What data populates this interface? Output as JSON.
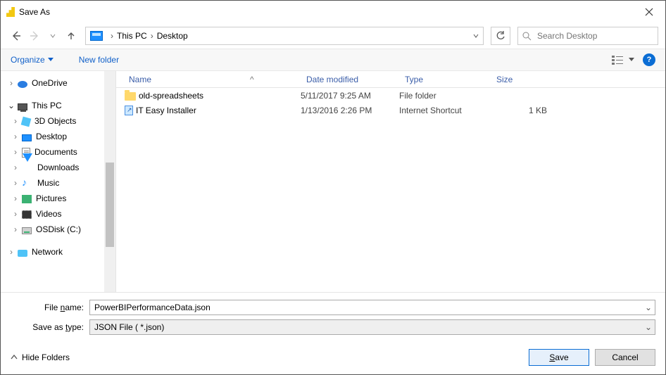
{
  "window": {
    "title": "Save As"
  },
  "breadcrumb": {
    "seg1": "This PC",
    "seg2": "Desktop"
  },
  "search": {
    "placeholder": "Search Desktop"
  },
  "toolbar": {
    "organize": "Organize",
    "newfolder": "New folder"
  },
  "tree": {
    "onedrive": "OneDrive",
    "thispc": "This PC",
    "objects3d": "3D Objects",
    "desktop": "Desktop",
    "documents": "Documents",
    "downloads": "Downloads",
    "music": "Music",
    "pictures": "Pictures",
    "videos": "Videos",
    "osdisk": "OSDisk (C:)",
    "network": "Network"
  },
  "columns": {
    "name": "Name",
    "date": "Date modified",
    "type": "Type",
    "size": "Size"
  },
  "rows": [
    {
      "name": "old-spreadsheets",
      "date": "5/11/2017 9:25 AM",
      "type": "File folder",
      "size": "",
      "kind": "folder"
    },
    {
      "name": "IT Easy Installer",
      "date": "1/13/2016 2:26 PM",
      "type": "Internet Shortcut",
      "size": "1 KB",
      "kind": "url"
    }
  ],
  "fields": {
    "filename_label_pre": "File ",
    "filename_label_u": "n",
    "filename_label_post": "ame:",
    "filename_value": "PowerBIPerformanceData.json",
    "saveas_label_pre": "Save as ",
    "saveas_label_u": "t",
    "saveas_label_post": "ype:",
    "saveas_value": "JSON File  ( *.json)"
  },
  "actions": {
    "hide": "Hide Folders",
    "save_pre": "",
    "save_u": "S",
    "save_post": "ave",
    "cancel": "Cancel"
  }
}
